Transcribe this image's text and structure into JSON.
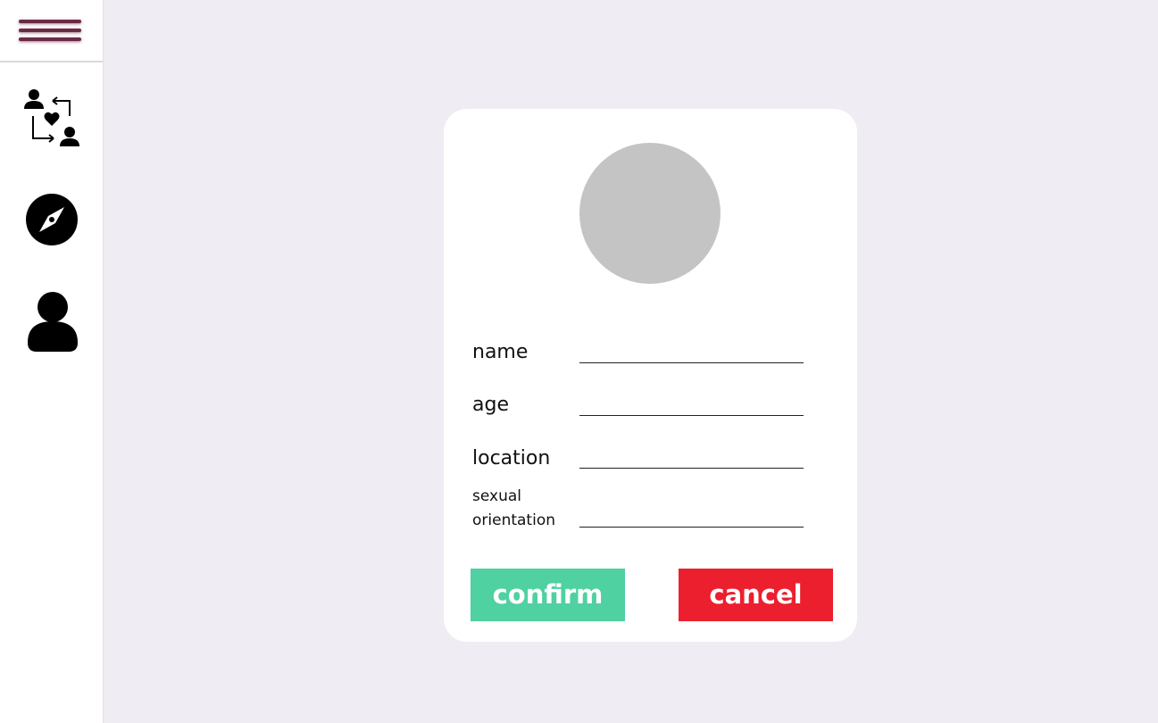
{
  "colors": {
    "page_bg": "#EFECF3",
    "accent_menu": "#6B2A45",
    "confirm": "#4FD1A1",
    "cancel": "#EC1F2E",
    "avatar_placeholder": "#C4C4C4"
  },
  "sidebar": {
    "icons": [
      "hamburger-menu-icon",
      "match-swap-icon",
      "compass-icon",
      "user-icon"
    ]
  },
  "form": {
    "fields": {
      "name": {
        "label": "name",
        "value": ""
      },
      "age": {
        "label": "age",
        "value": ""
      },
      "location": {
        "label": "location",
        "value": ""
      },
      "orientation": {
        "label_line1": "sexual",
        "label_line2": "orientation",
        "value": ""
      }
    },
    "confirm_label": "confirm",
    "cancel_label": "cancel"
  }
}
